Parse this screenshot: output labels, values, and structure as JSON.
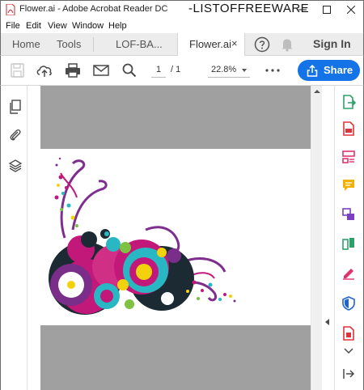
{
  "window": {
    "title": "Flower.ai - Adobe Acrobat Reader DC",
    "watermark": "-LISTOFFREEWARE"
  },
  "menu": {
    "items": [
      "File",
      "Edit",
      "View",
      "Window",
      "Help"
    ]
  },
  "tabs": {
    "home": "Home",
    "tools": "Tools",
    "doc1": "LOF-BA...",
    "doc2": "Flower.ai",
    "close_symbol": "×",
    "signin": "Sign In"
  },
  "toolbar": {
    "page_current": "1",
    "page_total": "/ 1",
    "zoom": "22.8%",
    "share_label": "Share"
  },
  "colors": {
    "accent": "#1473e6",
    "page_gray": "#a0a0a0",
    "tool_red": "#e0343c",
    "tool_purple": "#7b3fc4",
    "tool_green": "#2ca26a",
    "tool_yellow": "#f2b100",
    "tool_pink": "#e0336e",
    "tool_blue": "#1f64d1"
  },
  "icons": {
    "left_panel": [
      "pages-icon",
      "attachment-icon",
      "layers-icon"
    ],
    "right_panel": [
      "export-pdf-icon",
      "create-pdf-icon",
      "edit-pdf-icon",
      "comment-icon",
      "combine-files-icon",
      "organize-pages-icon",
      "fill-sign-icon",
      "protect-icon",
      "more-tools-icon"
    ]
  }
}
